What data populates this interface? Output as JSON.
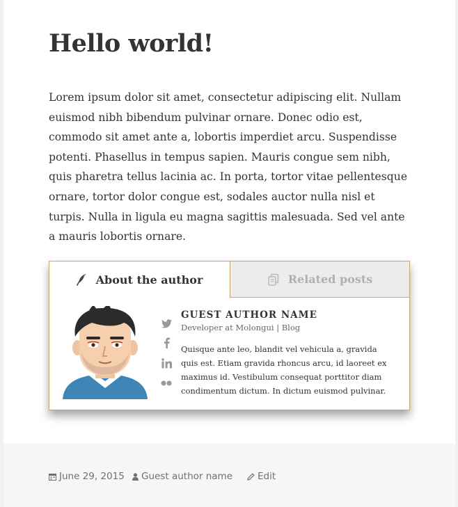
{
  "post": {
    "title": "Hello world!",
    "body": "Lorem ipsum dolor sit amet, consectetur adipiscing elit. Nullam euismod nibh bibendum pulvinar ornare. Donec odio est, commodo sit amet ante a, lobortis imperdiet arcu. Suspendisse potenti. Phasellus in tempus sapien. Mauris congue sem nibh, quis pharetra tellus lacinia ac. In porta, tortor vitae pellentesque ornare, tortor dolor congue est, sodales auctor nulla nisl et turpis. Nulla in ligula eu magna sagittis malesuada. Sed vel ante a mauris lobortis ornare."
  },
  "author_box": {
    "tabs": [
      {
        "label": "About the author",
        "icon": "quill-icon",
        "active": true
      },
      {
        "label": "Related posts",
        "icon": "copy-icon",
        "active": false
      }
    ],
    "name": "GUEST AUTHOR NAME",
    "role": "Developer at Molongui",
    "separator": " | ",
    "blog_label": "Blog",
    "bio": "Quisque ante leo, blandit vel vehicula a, gravida quis est. Etiam gravida rhoncus arcu, id laoreet ex maximus id. Vestibulum consequat porttitor diam condimentum dictum. In dictum euismod pulvinar.",
    "socials": [
      "twitter-icon",
      "facebook-icon",
      "linkedin-icon",
      "flickr-icon"
    ],
    "border_color": "#c9a56a"
  },
  "footer": {
    "date": "June 29, 2015",
    "author": "Guest author name",
    "edit": "Edit"
  }
}
